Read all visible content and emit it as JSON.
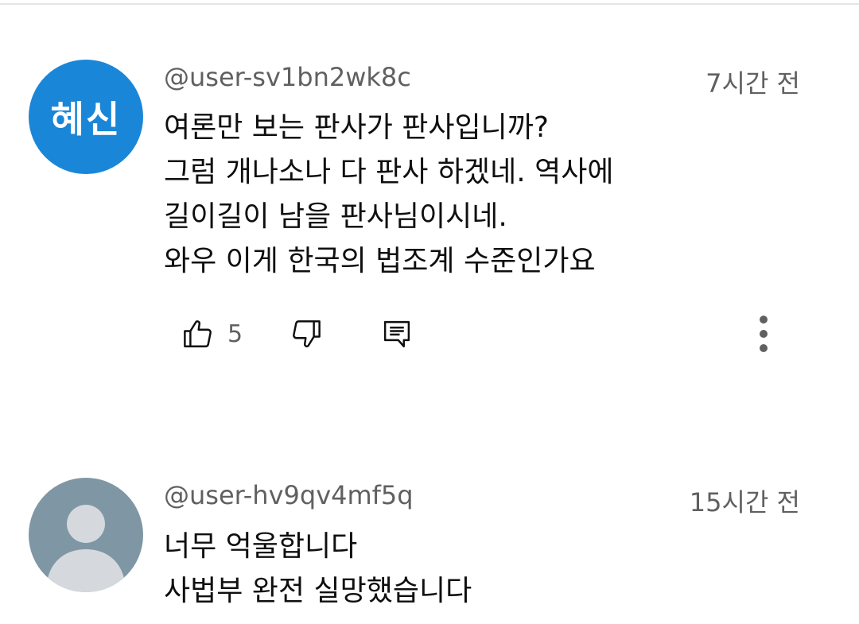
{
  "comments": [
    {
      "avatar_text": "혜신",
      "avatar_color": "#1a86d8",
      "author": "@user-sv1bn2wk8c",
      "time": "7시간 전",
      "lines": [
        "여론만 보는 판사가 판사입니까?",
        "그럼 개나소나 다 판사 하겠네. 역사에",
        "길이길이 남을 판사님이시네.",
        "와우 이게 한국의 법조계 수준인가요"
      ],
      "likes": "5",
      "actions": {
        "like_icon": "thumbs-up-icon",
        "dislike_icon": "thumbs-down-icon",
        "reply_icon": "reply-icon",
        "more_icon": "more-vertical-icon"
      }
    },
    {
      "avatar_color": "#7f97a4",
      "author": "@user-hv9qv4mf5q",
      "time": "15시간 전",
      "lines": [
        "너무 억울합니다",
        "사법부 완전 실망했습니다"
      ]
    }
  ]
}
